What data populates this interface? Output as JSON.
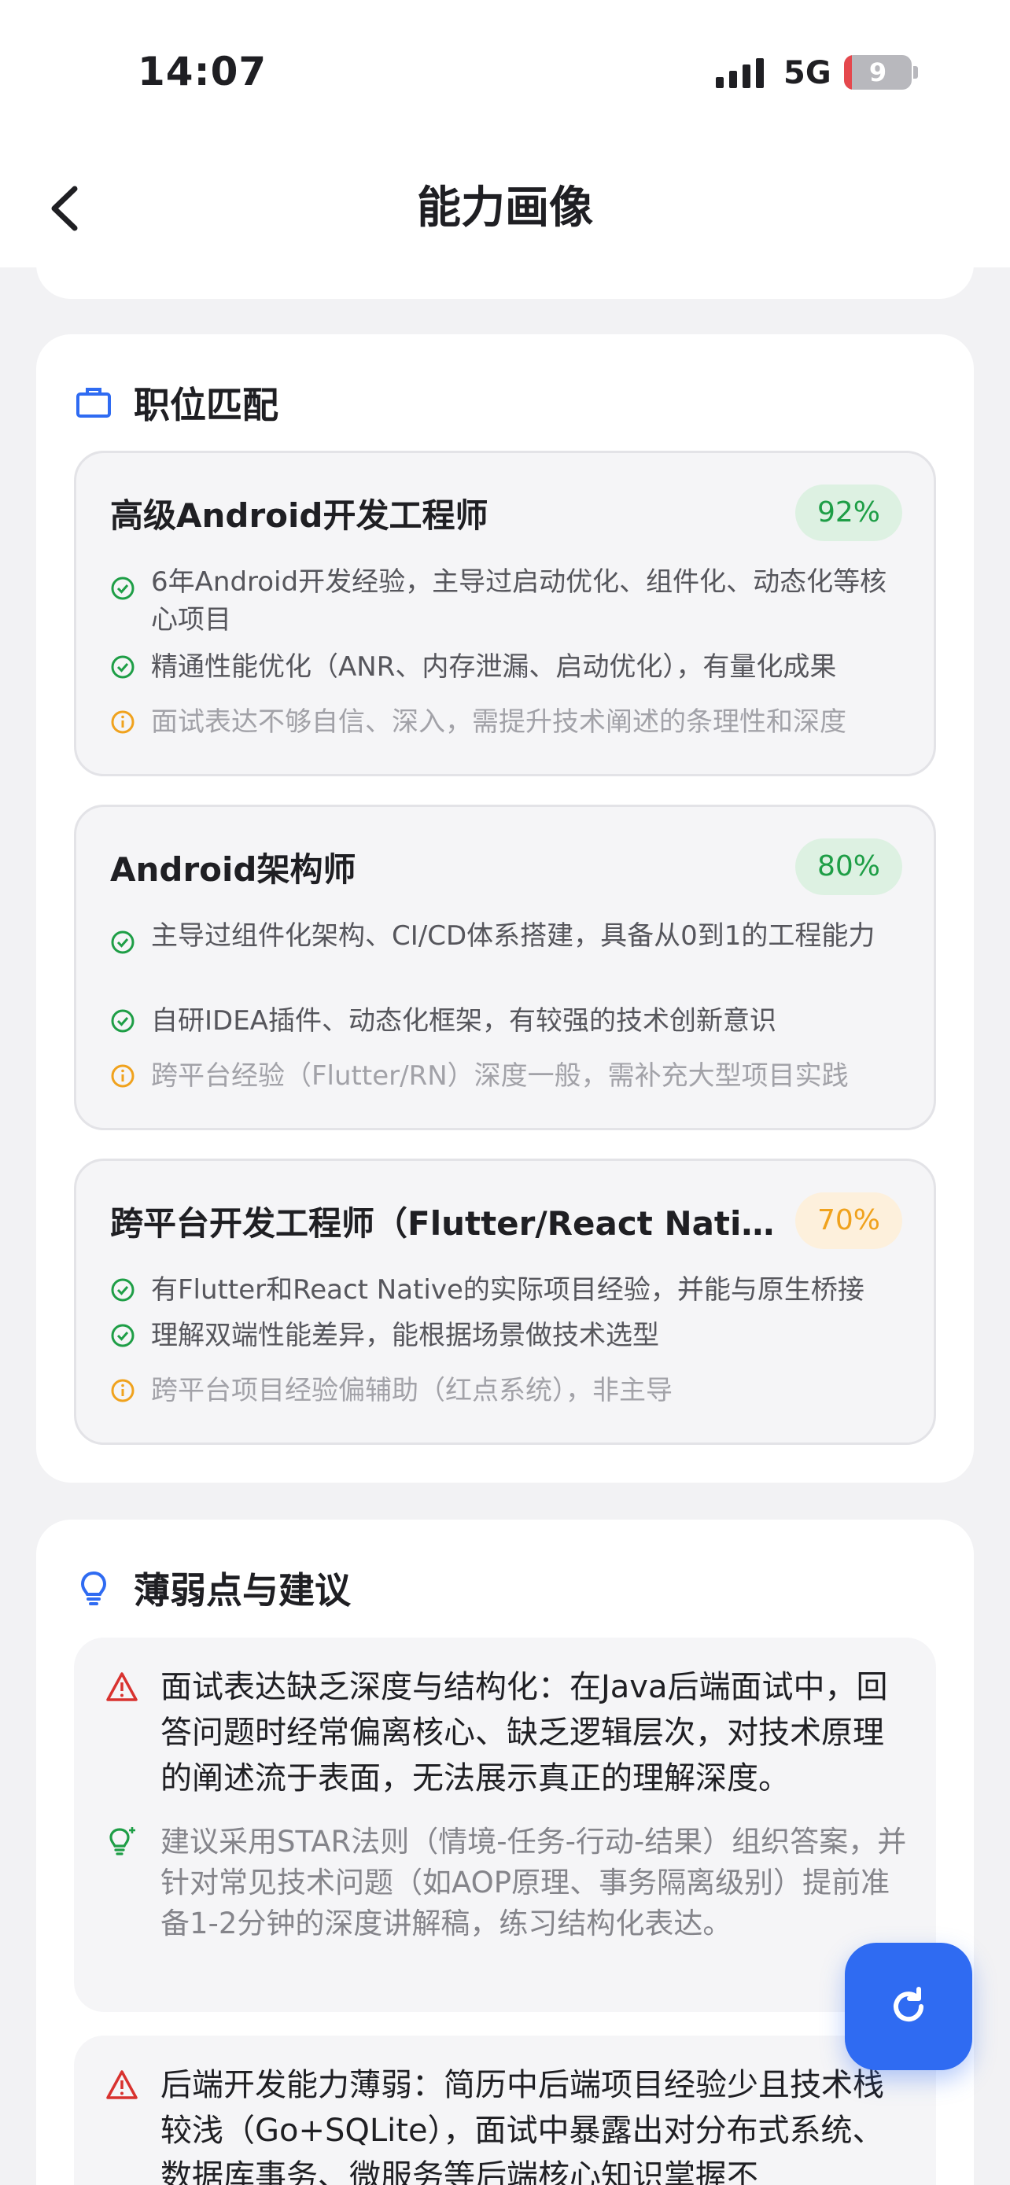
{
  "status": {
    "time": "14:07",
    "network": "5G",
    "battery": "9"
  },
  "header": {
    "title": "能力画像"
  },
  "job_match": {
    "section_title": "职位匹配",
    "items": [
      {
        "role": "高级Android开发工程师",
        "score": "92%",
        "pros": [
          "6年Android开发经验，主导过启动优化、组件化、动态化等核心项目",
          "精通性能优化（ANR、内存泄漏、启动优化），有量化成果"
        ],
        "con": "面试表达不够自信、深入，需提升技术阐述的条理性和深度"
      },
      {
        "role": "Android架构师",
        "score": "80%",
        "pros": [
          "主导过组件化架构、CI/CD体系搭建，具备从0到1的工程能力",
          "自研IDEA插件、动态化框架，有较强的技术创新意识"
        ],
        "con": "跨平台经验（Flutter/RN）深度一般，需补充大型项目实践"
      },
      {
        "role": "跨平台开发工程师（Flutter/React Native）",
        "score": "70%",
        "pros": [
          "有Flutter和React Native的实际项目经验，并能与原生桥接",
          "理解双端性能差异，能根据场景做技术选型"
        ],
        "con": "跨平台项目经验偏辅助（红点系统），非主导"
      }
    ]
  },
  "weakness": {
    "section_title": "薄弱点与建议",
    "items": [
      {
        "title": "面试表达缺乏深度与结构化：在Java后端面试中，回答问题时经常偏离核心、缺乏逻辑层次，对技术原理的阐述流于表面，无法展示真正的理解深度。",
        "suggestion": "建议采用STAR法则（情境-任务-行动-结果）组织答案，并针对常见技术问题（如AOP原理、事务隔离级别）提前准备1-2分钟的深度讲解稿，练习结构化表达。"
      },
      {
        "title": "后端开发能力薄弱：简历中后端项目经验少且技术栈较浅（Go+SQLite），面试中暴露出对分布式系统、数据库事务、微服务等后端核心知识掌握不",
        "suggestion": ""
      }
    ]
  },
  "colors": {
    "accent": "#2f6bf2",
    "good": "#1e9e46",
    "warn": "#f0a21d",
    "danger": "#d8322f"
  }
}
